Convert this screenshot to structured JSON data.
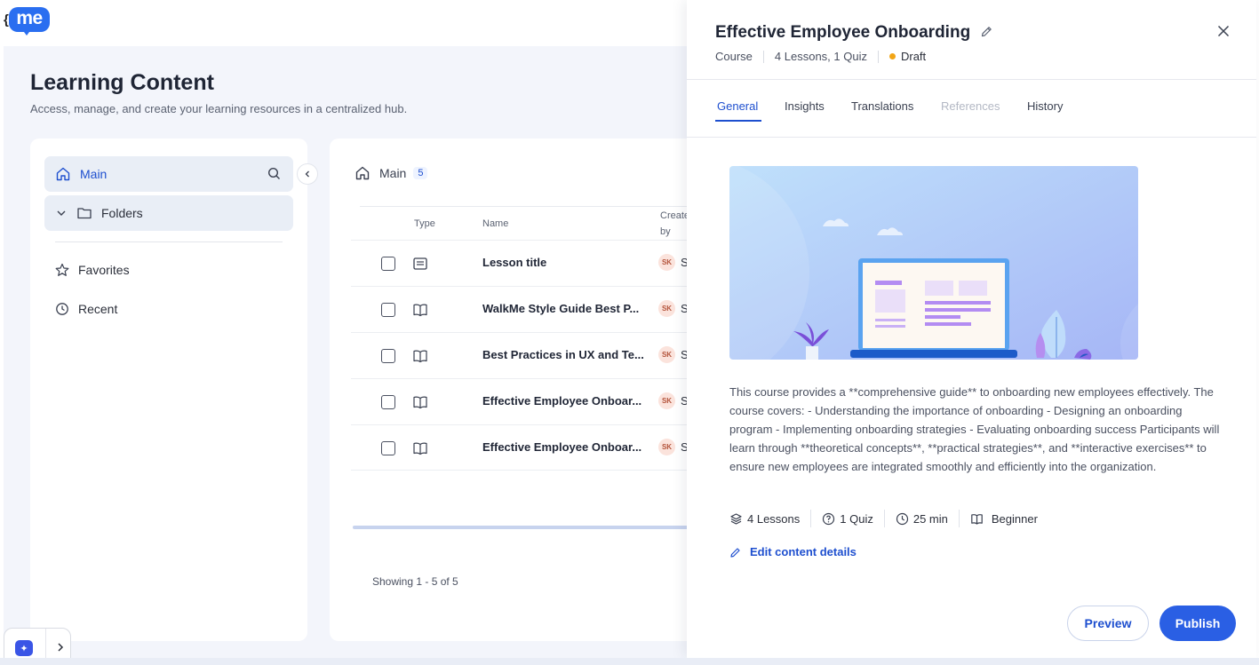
{
  "app": {
    "logo_text": "me"
  },
  "page": {
    "title": "Learning Content",
    "subtitle": "Access, manage, and create your learning resources in a centralized hub."
  },
  "sidebar": {
    "main_label": "Main",
    "folders_label": "Folders",
    "favorites_label": "Favorites",
    "recent_label": "Recent"
  },
  "list": {
    "breadcrumb": "Main",
    "count": "5",
    "columns": {
      "type": "Type",
      "name": "Name",
      "created_by_1": "Create",
      "created_by_2": "by"
    },
    "rows": [
      {
        "type_icon": "lesson-icon",
        "name": "Lesson title",
        "avatar": "SK",
        "creator": "S"
      },
      {
        "type_icon": "book-icon",
        "name": "WalkMe Style Guide Best P...",
        "avatar": "SK",
        "creator": "S"
      },
      {
        "type_icon": "book-icon",
        "name": "Best Practices in UX and Te...",
        "avatar": "SK",
        "creator": "S"
      },
      {
        "type_icon": "book-icon",
        "name": "Effective Employee Onboar...",
        "avatar": "SK",
        "creator": "S"
      },
      {
        "type_icon": "book-icon",
        "name": "Effective Employee Onboar...",
        "avatar": "SK",
        "creator": "S"
      }
    ],
    "showing": "Showing 1 - 5 of 5"
  },
  "drawer": {
    "title": "Effective Employee Onboarding",
    "meta": {
      "kind": "Course",
      "summary": "4 Lessons, 1 Quiz",
      "status": "Draft",
      "status_color": "#f2a516"
    },
    "tabs": [
      {
        "label": "General",
        "state": "active"
      },
      {
        "label": "Insights",
        "state": "normal"
      },
      {
        "label": "Translations",
        "state": "normal"
      },
      {
        "label": "References",
        "state": "disabled"
      },
      {
        "label": "History",
        "state": "normal"
      }
    ],
    "description": "This course provides a **comprehensive guide** to onboarding new employees effectively. The course covers: - Understanding the importance of onboarding - Designing an onboarding program - Implementing onboarding strategies - Evaluating onboarding success Participants will learn through **theoretical concepts**, **practical strategies**, and **interactive exercises** to ensure new employees are integrated smoothly and efficiently into the organization.",
    "stats": {
      "lessons": "4 Lessons",
      "quiz": "1 Quiz",
      "duration": "25 min",
      "level": "Beginner"
    },
    "edit_link": "Edit content details",
    "preview_label": "Preview",
    "publish_label": "Publish"
  },
  "colors": {
    "accent": "#1e4fcf",
    "primary_button": "#2a5fe4",
    "background": "#f3f5fb"
  }
}
